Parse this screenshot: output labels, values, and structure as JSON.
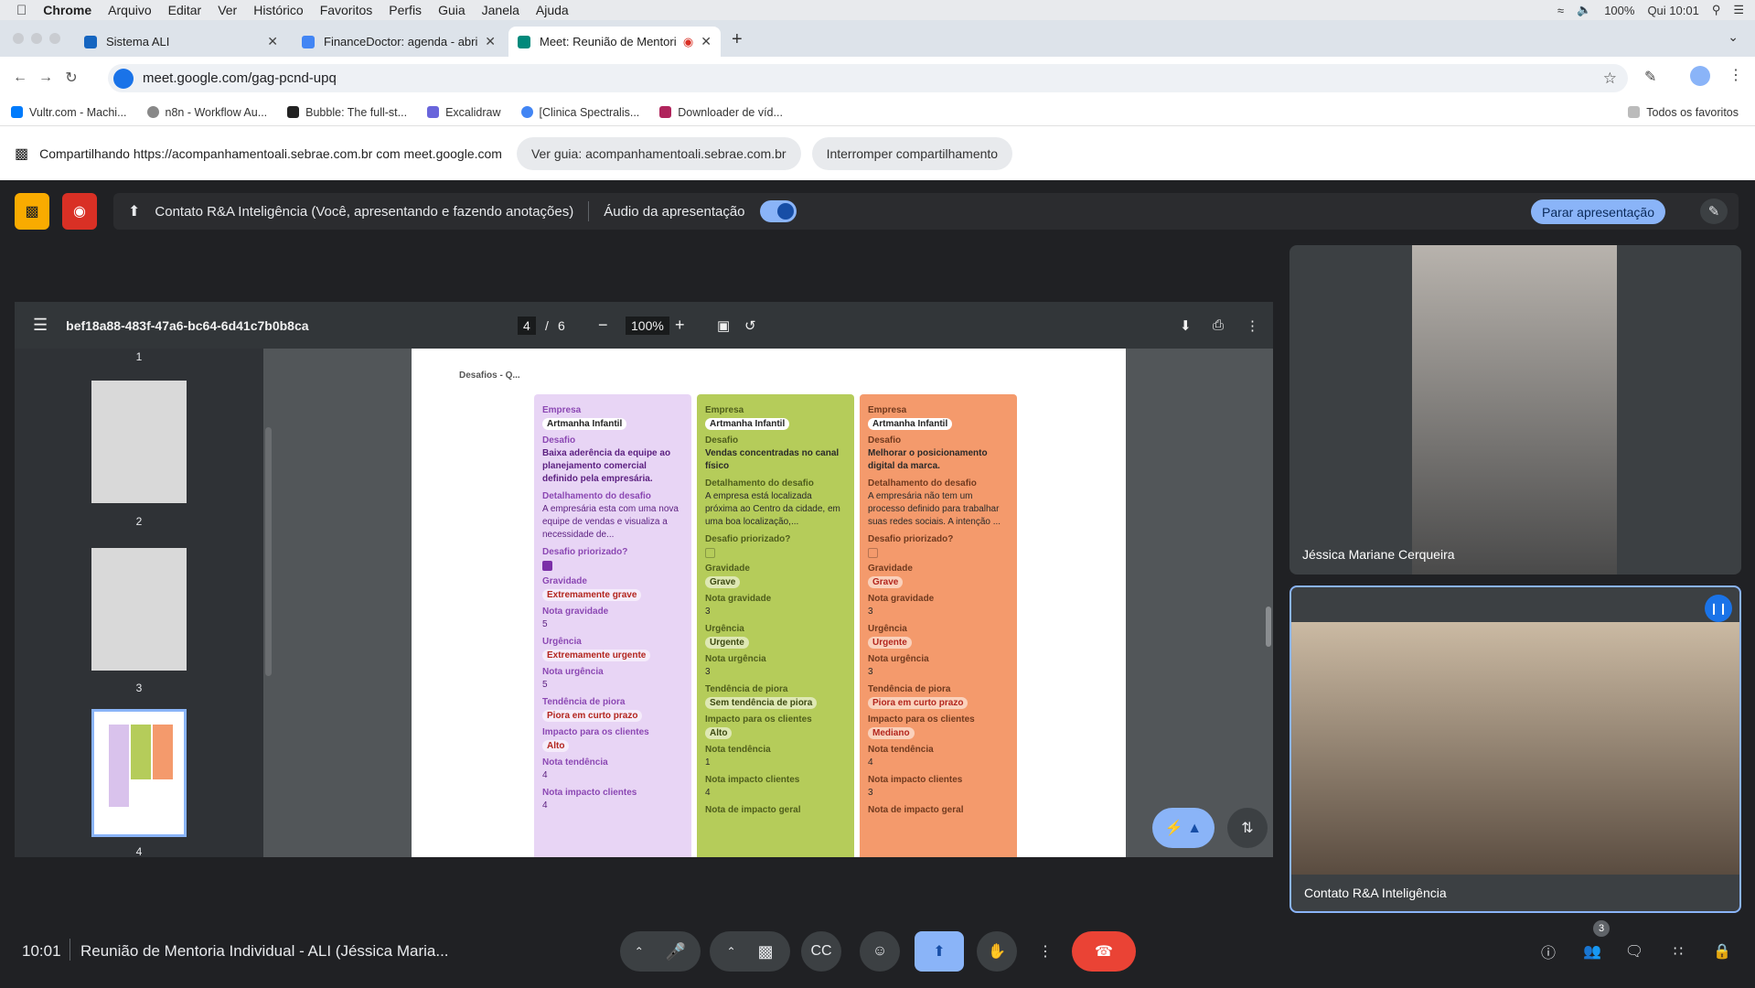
{
  "menubar": {
    "app": "Chrome",
    "items": [
      "Arquivo",
      "Editar",
      "Ver",
      "Histórico",
      "Favoritos",
      "Perfis",
      "Guia",
      "Janela",
      "Ajuda"
    ],
    "battery": "100%",
    "clock": "Qui 10:01"
  },
  "tabs": [
    {
      "title": "Sistema ALI"
    },
    {
      "title": "FinanceDoctor: agenda - abril"
    },
    {
      "title": "Meet: Reunião de Mentori"
    }
  ],
  "address": {
    "url": "meet.google.com/gag-pcnd-upq"
  },
  "bookmarks": [
    "Vultr.com - Machi...",
    "n8n - Workflow Au...",
    "Bubble: The full-st...",
    "Excalidraw",
    "[Clinica Spectralis...",
    "Downloader de víd..."
  ],
  "bookmarks_all": "Todos os favoritos",
  "share": {
    "text": "Compartilhando https://acompanhamentoali.sebrae.com.br com meet.google.com",
    "view_btn": "Ver guia: acompanhamentoali.sebrae.com.br",
    "stop_btn": "Interromper compartilhamento"
  },
  "presentation": {
    "label": "Contato R&A Inteligência (Você, apresentando e fazendo anotações)",
    "audio_label": "Áudio da apresentação",
    "stop_btn": "Parar apresentação"
  },
  "pdf": {
    "filename": "bef18a88-483f-47a6-bc64-6d41c7b0b8ca",
    "page": "4",
    "page_sep": "/",
    "pages": "6",
    "zoom": "100%",
    "thumbs": [
      "1",
      "2",
      "3",
      "4"
    ],
    "page_title": "Desafios - Q...",
    "cards": [
      {
        "empresa_label": "Empresa",
        "empresa": "Artmanha Infantil",
        "desafio_label": "Desafio",
        "desafio": "Baixa aderência da equipe ao planejamento comercial definido pela empresária.",
        "det_label": "Detalhamento do desafio",
        "det": "A empresária esta com uma nova equipe de vendas e visualiza a necessidade de...",
        "prior_label": "Desafio priorizado?",
        "grav_label": "Gravidade",
        "grav": "Extremamente grave",
        "ngrav_label": "Nota gravidade",
        "ngrav": "5",
        "urg_label": "Urgência",
        "urg": "Extremamente urgente",
        "nurg_label": "Nota urgência",
        "nurg": "5",
        "tend_label": "Tendência de piora",
        "tend": "Piora em curto prazo",
        "imp_label": "Impacto para os clientes",
        "imp": "Alto",
        "ntend_label": "Nota tendência",
        "ntend": "4",
        "nimp_label": "Nota impacto clientes",
        "nimp": "4",
        "ngeral_label": ""
      },
      {
        "empresa_label": "Empresa",
        "empresa": "Artmanha Infantil",
        "desafio_label": "Desafio",
        "desafio": "Vendas concentradas no canal físico",
        "det_label": "Detalhamento do desafio",
        "det": "A empresa está localizada próxima ao Centro da cidade, em uma boa localização,...",
        "prior_label": "Desafio priorizado?",
        "grav_label": "Gravidade",
        "grav": "Grave",
        "ngrav_label": "Nota gravidade",
        "ngrav": "3",
        "urg_label": "Urgência",
        "urg": "Urgente",
        "nurg_label": "Nota urgência",
        "nurg": "3",
        "tend_label": "Tendência de piora",
        "tend": "Sem tendência de piora",
        "imp_label": "Impacto para os clientes",
        "imp": "Alto",
        "ntend_label": "Nota tendência",
        "ntend": "1",
        "nimp_label": "Nota impacto clientes",
        "nimp": "4",
        "ngeral_label": "Nota de impacto geral"
      },
      {
        "empresa_label": "Empresa",
        "empresa": "Artmanha Infantil",
        "desafio_label": "Desafio",
        "desafio": "Melhorar o posicionamento digital da marca.",
        "det_label": "Detalhamento do desafio",
        "det": "A empresária não tem um processo definido para trabalhar suas redes sociais. A intenção ...",
        "prior_label": "Desafio priorizado?",
        "grav_label": "Gravidade",
        "grav": "Grave",
        "ngrav_label": "Nota gravidade",
        "ngrav": "3",
        "urg_label": "Urgência",
        "urg": "Urgente",
        "nurg_label": "Nota urgência",
        "nurg": "3",
        "tend_label": "Tendência de piora",
        "tend": "Piora em curto prazo",
        "imp_label": "Impacto para os clientes",
        "imp": "Mediano",
        "ntend_label": "Nota tendência",
        "ntend": "4",
        "nimp_label": "Nota impacto clientes",
        "nimp": "3",
        "ngeral_label": "Nota de impacto geral"
      }
    ]
  },
  "participants": {
    "p1": "Jéssica Mariane Cerqueira",
    "p2": "Contato R&A Inteligência",
    "count": "3"
  },
  "meeting": {
    "time": "10:01",
    "title": "Reunião de Mentoria Individual - ALI (Jéssica Maria..."
  },
  "colors": {
    "accent": "#8ab4f8",
    "end_call": "#ea4335",
    "card1": "#e8d5f5",
    "card2": "#b5cc5a",
    "card3": "#f49a6c"
  }
}
